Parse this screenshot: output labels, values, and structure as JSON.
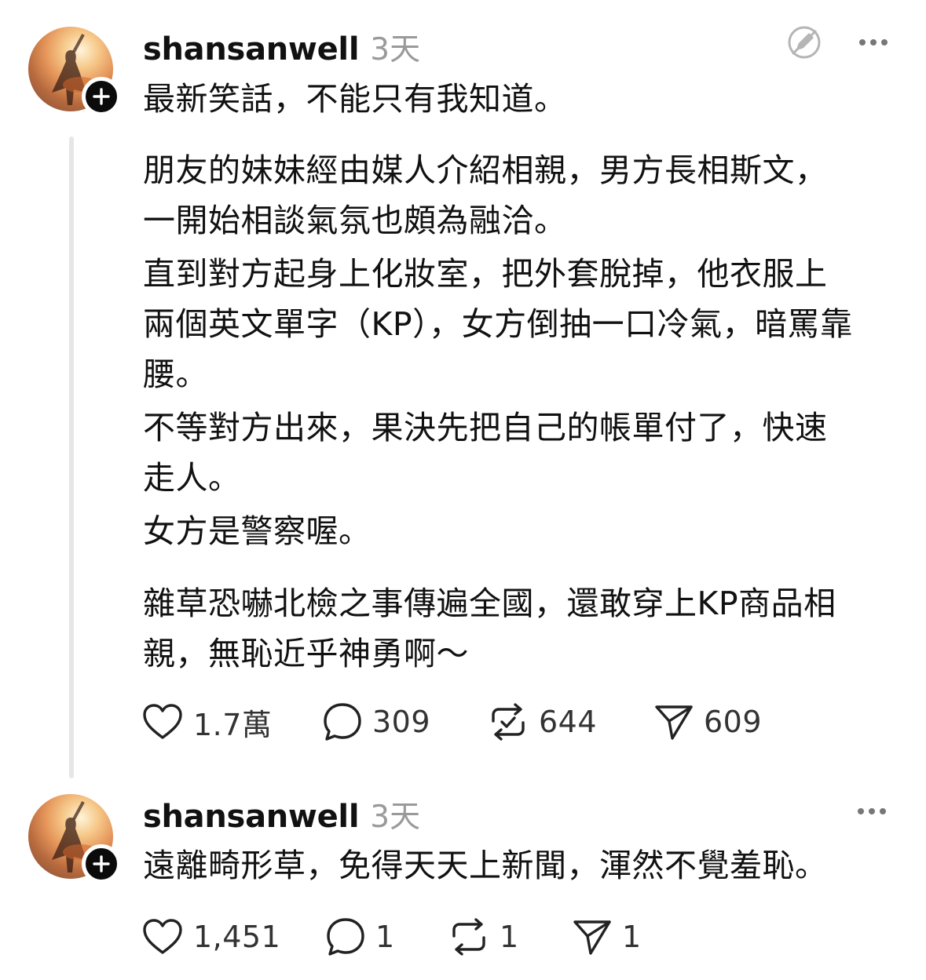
{
  "posts": [
    {
      "username": "shansanwell",
      "time": "3天",
      "lines": [
        "最新笑話，不能只有我知道。",
        "朋友的妹妹經由媒人介紹相親，男方長相斯文，",
        "一開始相談氣氛也頗為融洽。",
        "直到對方起身上化妝室，把外套脫掉，他衣服上",
        "兩個英文單字（KP），女方倒抽一口冷氣，暗罵靠",
        "腰。",
        "不等對方出來，果決先把自己的帳單付了，快速",
        "走人。",
        "女方是警察喔。",
        "雜草恐嚇北檢之事傳遍全國，還敢穿上KP商品相",
        "親，無恥近乎神勇啊～"
      ],
      "stats": {
        "likes": "1.7萬",
        "comments": "309",
        "reposts": "644",
        "shares": "609"
      }
    },
    {
      "username": "shansanwell",
      "time": "3天",
      "lines": [
        "遠離畸形草，免得天天上新聞，渾然不覺羞恥。"
      ],
      "stats": {
        "likes": "1,451",
        "comments": "1",
        "reposts": "1",
        "shares": "1"
      }
    }
  ],
  "icons": {
    "follow": "plus-icon",
    "edit_muted": "edit-off-icon",
    "more": "more-dots-icon",
    "like": "heart-icon",
    "comment": "comment-bubble-icon",
    "repost": "repost-icon",
    "share": "send-icon"
  },
  "colors": {
    "text": "#111111",
    "muted": "#9a9a9a",
    "thread_line": "#e6e6e6",
    "badge": "#0b0b0b"
  }
}
